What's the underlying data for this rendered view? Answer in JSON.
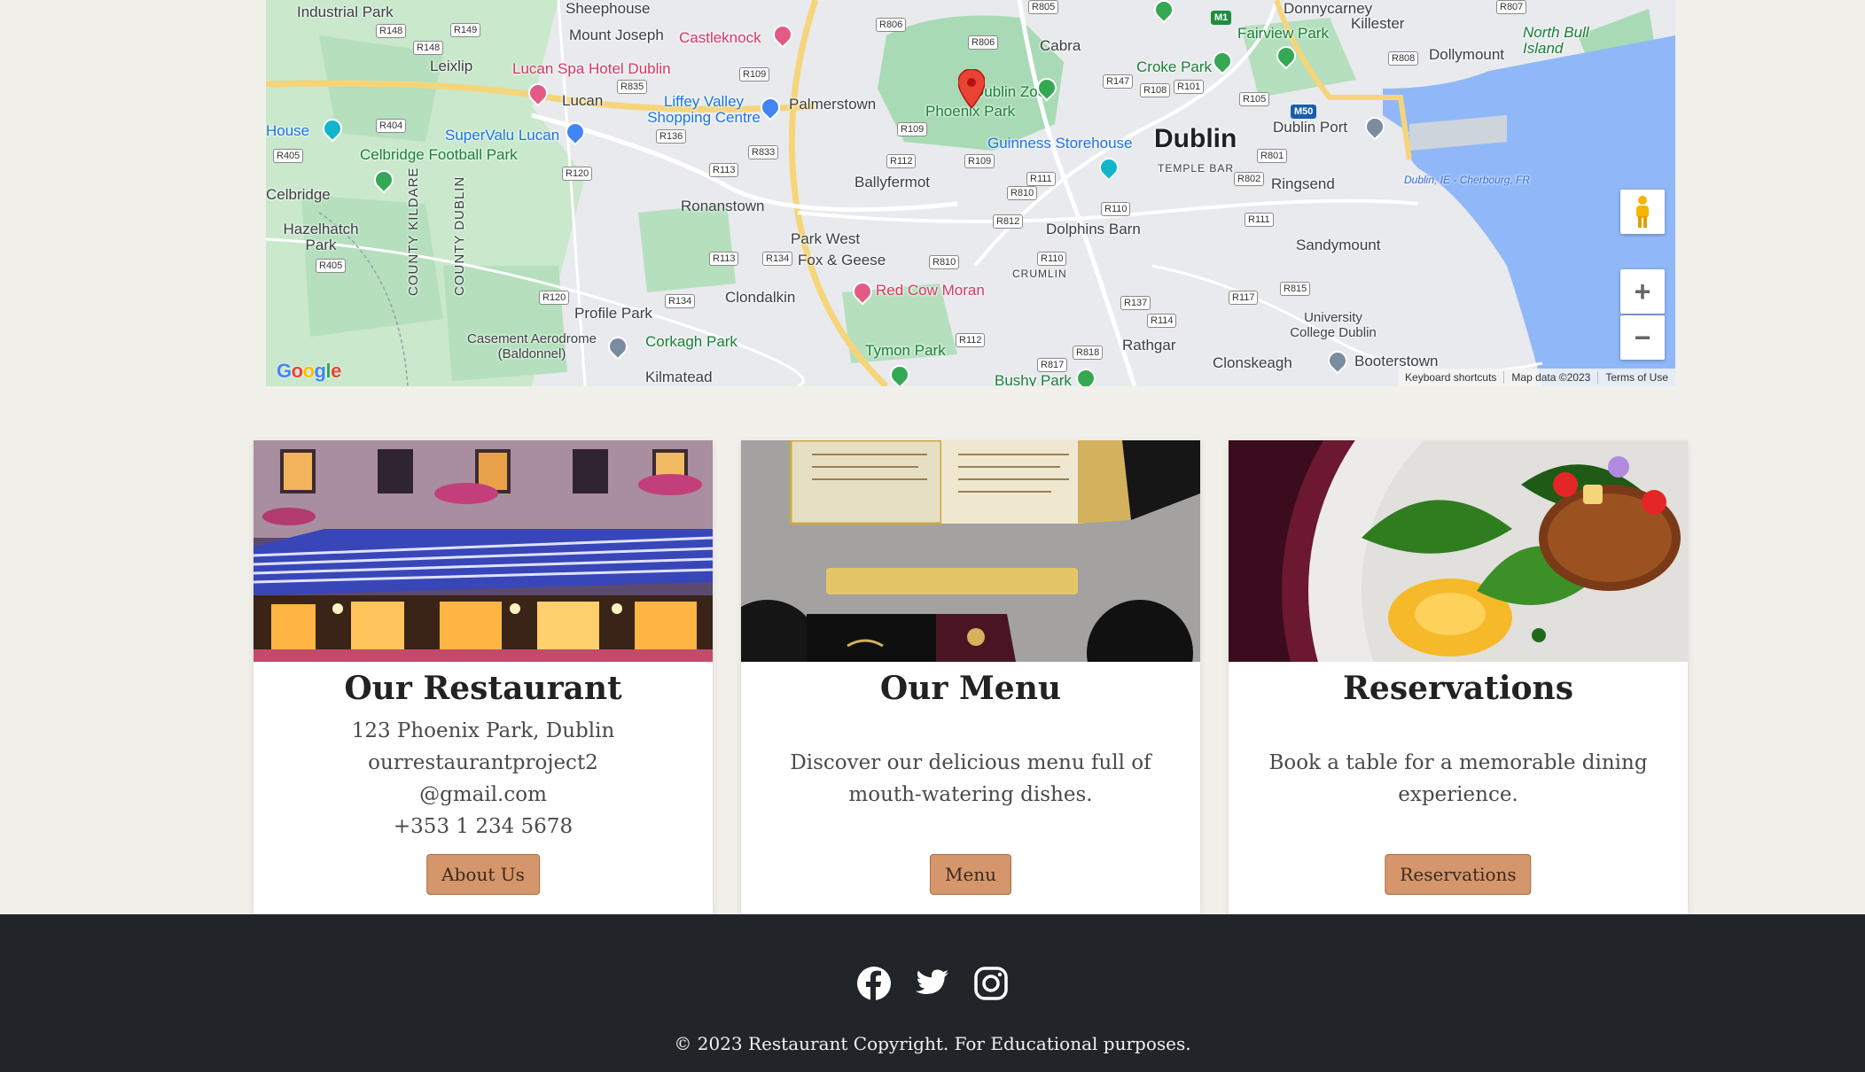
{
  "map": {
    "places": [
      {
        "text": "Industrial Park",
        "cls": ""
      },
      {
        "text": "Sheephouse",
        "cls": ""
      },
      {
        "text": "Mount Joseph",
        "cls": ""
      },
      {
        "text": "Castleknock",
        "cls": "poi-red"
      },
      {
        "text": "Cabra",
        "cls": ""
      },
      {
        "text": "Donnycarney",
        "cls": ""
      },
      {
        "text": "Killester",
        "cls": ""
      },
      {
        "text": "Fairview Park",
        "cls": "poi-green"
      },
      {
        "text": "North Bull Island",
        "cls": "poi-green"
      },
      {
        "text": "Dollymount",
        "cls": ""
      },
      {
        "text": "Leixlip",
        "cls": ""
      },
      {
        "text": "Lucan Spa Hotel Dublin",
        "cls": "poi-red"
      },
      {
        "text": "Lucan",
        "cls": ""
      },
      {
        "text": "Liffey Valley Shopping Centre",
        "cls": "poi-blue"
      },
      {
        "text": "Palmerstown",
        "cls": ""
      },
      {
        "text": "Dublin Zoo",
        "cls": "poi-green"
      },
      {
        "text": "Phoenix Park",
        "cls": "poi-green"
      },
      {
        "text": "Croke Park",
        "cls": "poi-green"
      },
      {
        "text": "Dublin",
        "cls": "big"
      },
      {
        "text": "Dublin Port",
        "cls": ""
      },
      {
        "text": "SuperValu Lucan",
        "cls": "poi-blue"
      },
      {
        "text": "Celbridge Football Park",
        "cls": "poi-green"
      },
      {
        "text": "House",
        "cls": "poi-blue"
      },
      {
        "text": "Guinness Storehouse",
        "cls": "poi-blue"
      },
      {
        "text": "TEMPLE BAR",
        "cls": "small"
      },
      {
        "text": "Ballyfermot",
        "cls": ""
      },
      {
        "text": "Ringsend",
        "cls": ""
      },
      {
        "text": "Dublin, IE - Cherbourg, FR",
        "cls": "water"
      },
      {
        "text": "Celbridge",
        "cls": ""
      },
      {
        "text": "Ronanstown",
        "cls": ""
      },
      {
        "text": "Dolphins Barn",
        "cls": ""
      },
      {
        "text": "Hazelhatch Park",
        "cls": ""
      },
      {
        "text": "Park West",
        "cls": ""
      },
      {
        "text": "Fox & Geese",
        "cls": ""
      },
      {
        "text": "Sandymount",
        "cls": ""
      },
      {
        "text": "CRUMLIN",
        "cls": "small"
      },
      {
        "text": "Red Cow Moran",
        "cls": "poi-red"
      },
      {
        "text": "Clondalkin",
        "cls": ""
      },
      {
        "text": "Profile Park",
        "cls": ""
      },
      {
        "text": "University College Dublin",
        "cls": ""
      },
      {
        "text": "Casement Aerodrome (Baldonnel)",
        "cls": ""
      },
      {
        "text": "Corkagh Park",
        "cls": "poi-green"
      },
      {
        "text": "Rathgar",
        "cls": ""
      },
      {
        "text": "Tymon Park",
        "cls": "poi-green"
      },
      {
        "text": "Clonskeagh",
        "cls": ""
      },
      {
        "text": "Booterstown",
        "cls": ""
      },
      {
        "text": "Kilmatead",
        "cls": ""
      },
      {
        "text": "Bushy Park",
        "cls": "poi-green"
      },
      {
        "text": "COUNTY KILDARE",
        "cls": "vert"
      },
      {
        "text": "COUNTY DUBLIN",
        "cls": "vert"
      }
    ],
    "road_labels": [
      "R148",
      "R149",
      "R806",
      "R805",
      "R807",
      "R148",
      "R835",
      "R109",
      "R806",
      "R147",
      "R108",
      "R101",
      "R105",
      "R808",
      "R404",
      "R136",
      "R833",
      "R109",
      "R112",
      "R109",
      "R801",
      "R405",
      "R120",
      "R113",
      "R111",
      "R810",
      "R802",
      "R812",
      "R110",
      "R111",
      "R405",
      "R113",
      "R134",
      "R810",
      "R110",
      "R815",
      "R120",
      "R134",
      "R137",
      "R114",
      "R117",
      "R112",
      "R817",
      "R818",
      "M50",
      "M1"
    ],
    "keyboard_shortcuts": "Keyboard shortcuts",
    "map_data": "Map data ©2023",
    "terms": "Terms of Use",
    "logo": "Google",
    "zoom_in": "+",
    "zoom_out": "−",
    "colors": {
      "land": "#e8eaed",
      "park": "#a8dab5",
      "water": "#90b8f8"
    }
  },
  "cards": [
    {
      "title": "Our Restaurant",
      "lines": [
        "123 Phoenix Park, Dublin",
        "ourrestaurantproject2",
        "@gmail.com",
        "+353 1 234 5678"
      ],
      "button": "About Us",
      "image": "restaurant-exterior-image"
    },
    {
      "title": "Our Menu",
      "text": "Discover our delicious menu full of mouth-watering dishes.",
      "button": "Menu",
      "image": "menu-image"
    },
    {
      "title": "Reservations",
      "text": "Book a table for a memorable dining experience.",
      "button": "Reservations",
      "image": "dish-image"
    }
  ],
  "footer": {
    "social_icons": [
      "facebook-icon",
      "twitter-icon",
      "instagram-icon"
    ],
    "copyright": "© 2023 Restaurant Copyright. For Educational purposes."
  },
  "colors": {
    "page_bg": "#f2f0eb",
    "button_bg": "#d4966a",
    "footer_bg": "#212529"
  }
}
